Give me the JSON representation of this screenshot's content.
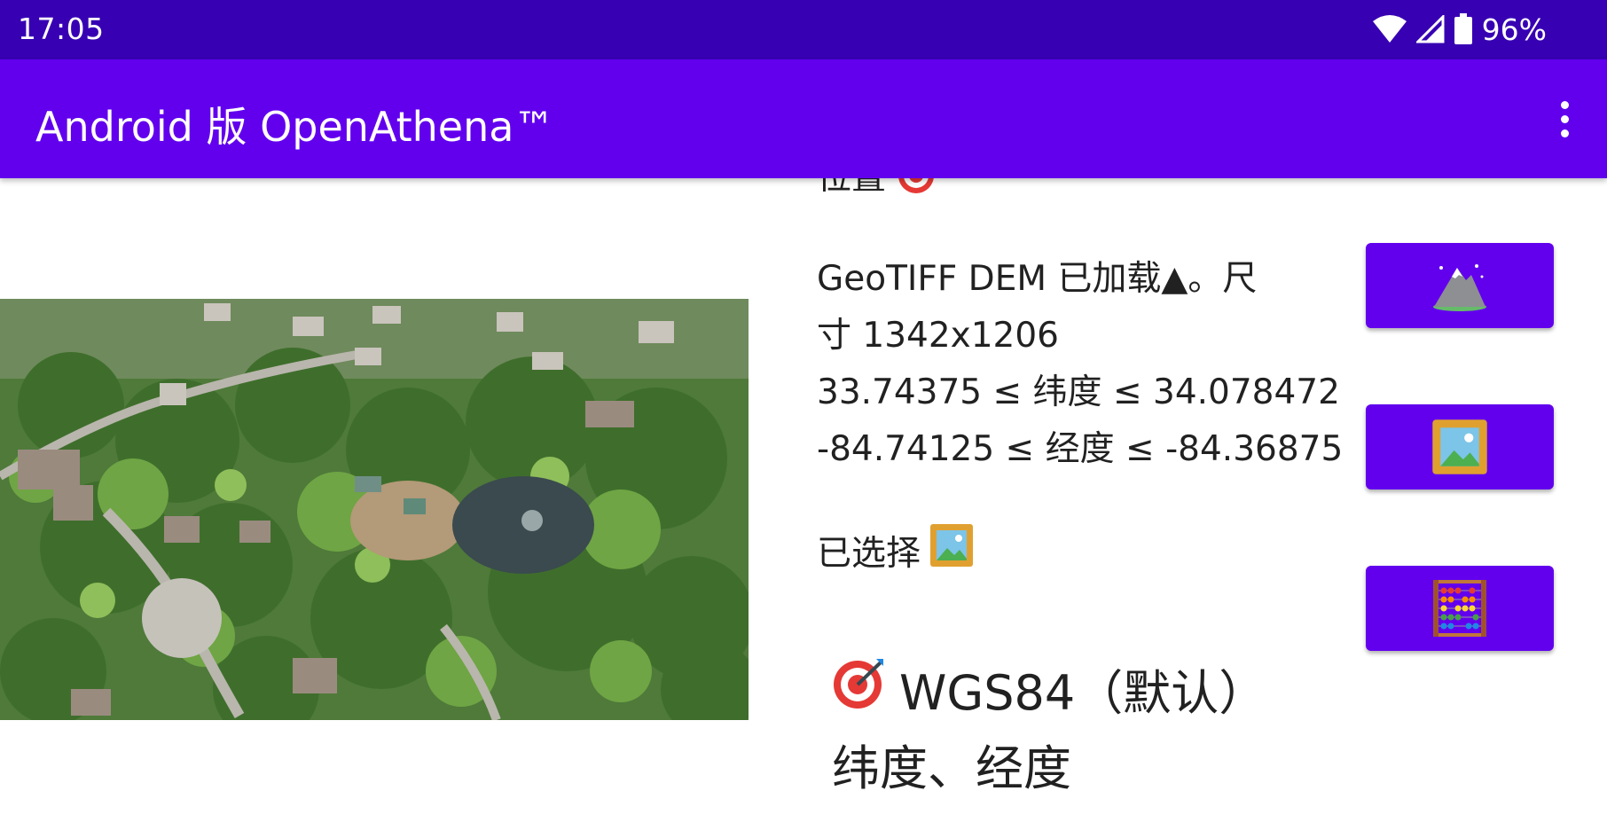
{
  "status_bar": {
    "time": "17:05",
    "battery": "96%",
    "icons": [
      "wifi-icon",
      "cell-signal-icon",
      "battery-icon"
    ]
  },
  "app_bar": {
    "title": "Android 版 OpenAthena™",
    "menu_icon": "overflow-menu-icon"
  },
  "main": {
    "location_label": "位置",
    "location_icon": "target-icon",
    "dem_status_lines": [
      "GeoTIFF DEM 已加载▲。尺",
      "寸 1342x1206",
      "33.74375 ≤ 纬度 ≤ 34.078472",
      "-84.74125 ≤ 经度 ≤ -84.36875"
    ],
    "selected_label": "已选择",
    "selected_icon": "framed-picture-icon",
    "output_line1": "WGS84（默认）",
    "output_line2": "纬度、经度",
    "output_icon": "bullseye-icon",
    "image_description": "aerial-drone-photo"
  },
  "buttons": {
    "dem_button_icon": "mountain-icon",
    "image_button_icon": "framed-picture-icon",
    "calculate_button_icon": "abacus-icon"
  },
  "colors": {
    "status_bar": "#3700b3",
    "app_bar": "#6200ee",
    "button": "#6200ee",
    "text": "#212121",
    "background": "#ffffff"
  }
}
